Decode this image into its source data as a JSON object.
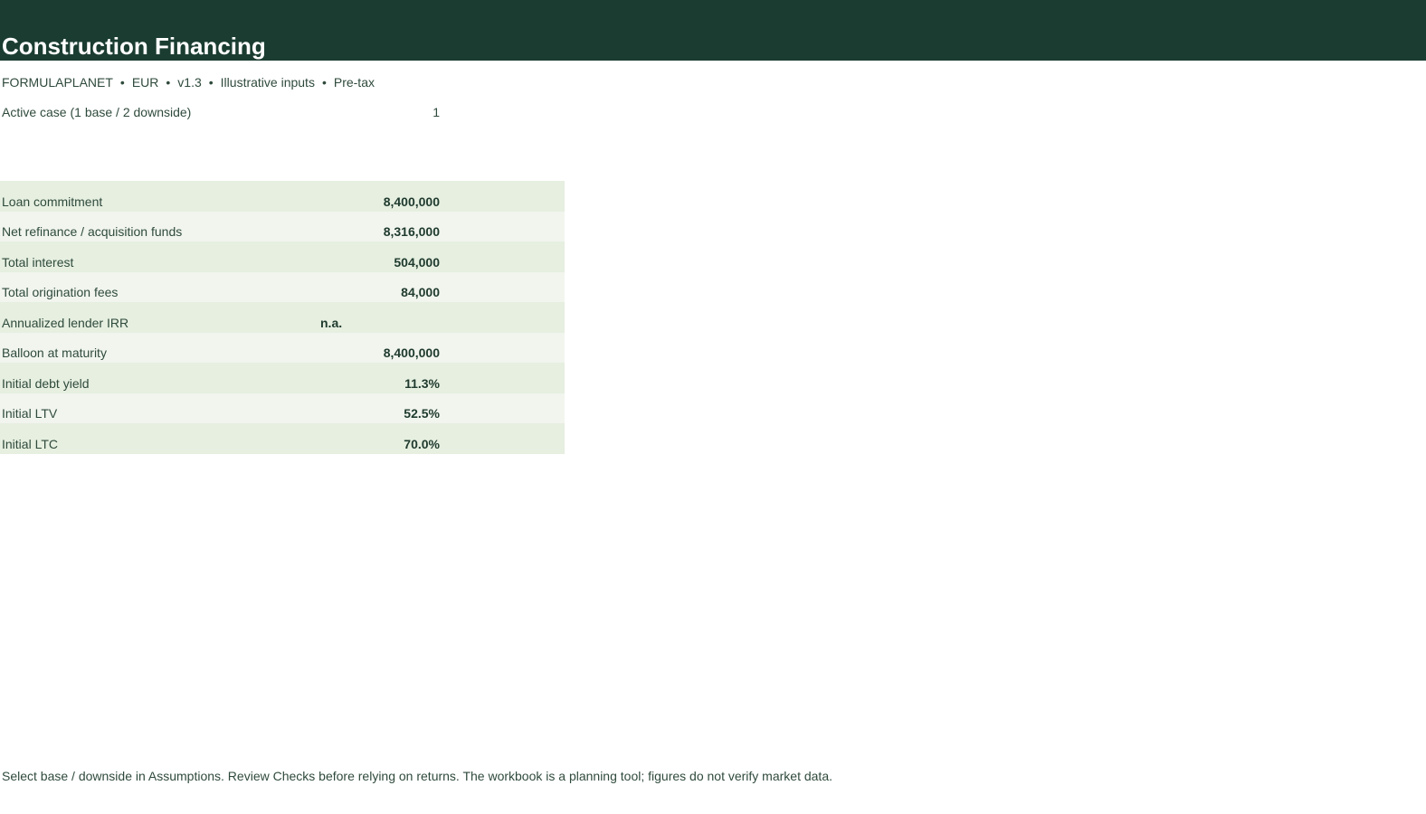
{
  "header": {
    "title": "Construction Financing",
    "subtitle_items": [
      "FORMULAPLANET",
      "EUR",
      "v1.3",
      "Illustrative inputs",
      "Pre-tax"
    ],
    "separator": "•"
  },
  "active_case": {
    "label": "Active case (1 base / 2 downside)",
    "value": "1"
  },
  "metrics": [
    {
      "label": "Loan commitment",
      "value": "8,400,000"
    },
    {
      "label": "Net refinance / acquisition funds",
      "value": "8,316,000"
    },
    {
      "label": "Total interest",
      "value": "504,000"
    },
    {
      "label": "Total origination fees",
      "value": "84,000"
    },
    {
      "label": "Annualized lender IRR",
      "value": "n.a."
    },
    {
      "label": "Balloon at maturity",
      "value": "8,400,000"
    },
    {
      "label": "Initial debt yield",
      "value": "11.3%"
    },
    {
      "label": "Initial LTV",
      "value": "52.5%"
    },
    {
      "label": "Initial LTC",
      "value": "70.0%"
    }
  ],
  "footnote": "Select base / downside in Assumptions. Review Checks before relying on returns. The workbook is a planning tool; figures do not verify market data.",
  "colors": {
    "header_bg": "#1b3d31",
    "row_odd": "#e6efe0",
    "row_even": "#f1f5ee",
    "text": "#2f4a3c"
  }
}
